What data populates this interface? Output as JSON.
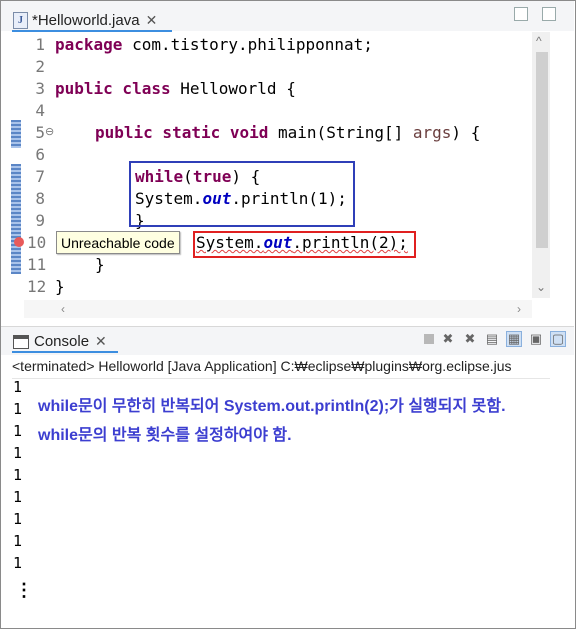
{
  "editor": {
    "tab_title": "*Helloworld.java",
    "tab_close": "✕",
    "file_icon_letter": "J",
    "line_numbers": [
      "1",
      "2",
      "3",
      "4",
      "5",
      "6",
      "7",
      "8",
      "9",
      "10",
      "11",
      "12"
    ],
    "lines": {
      "l1_kw": "package",
      "l1_rest": " com.tistory.philipponnat;",
      "l3_kw": "public class",
      "l3_rest": " Helloworld {",
      "l5_kw": "public static void",
      "l5_rest": " main(String[] ",
      "l5_param": "args",
      "l5_end": ") {",
      "l7_kw_while": "while",
      "l7_paren_open": "(",
      "l7_kw_true": "true",
      "l7_rest": ") {",
      "l8_sys": "System.",
      "l8_out": "out",
      "l8_rest": ".println(1);",
      "l9": "}",
      "l10_sys": "System.",
      "l10_out": "out",
      "l10_rest": ".println(2);",
      "l11": "}",
      "l12": "}"
    },
    "tooltip": "Unreachable code"
  },
  "console": {
    "tab_title": "Console",
    "tab_close": "✕",
    "terminated": "<terminated> Helloworld [Java Application] C:₩eclipse₩plugins₩org.eclipse.jus",
    "output_lines": [
      "1",
      "1",
      "1",
      "1",
      "1",
      "1",
      "1",
      "1",
      "1"
    ],
    "note_line1": "while문이 무한히 반복되어 System.out.println(2);가 실행되지 못함.",
    "note_line2": "while문의 반복 횟수를 설정하여야 함.",
    "ellipsis": "⋮"
  },
  "colors": {
    "keyword": "#7f0055",
    "field": "#0000c0",
    "annotation_blue": "#2f3fb8",
    "annotation_red": "#e02020",
    "note_text": "#3c3ed0"
  }
}
